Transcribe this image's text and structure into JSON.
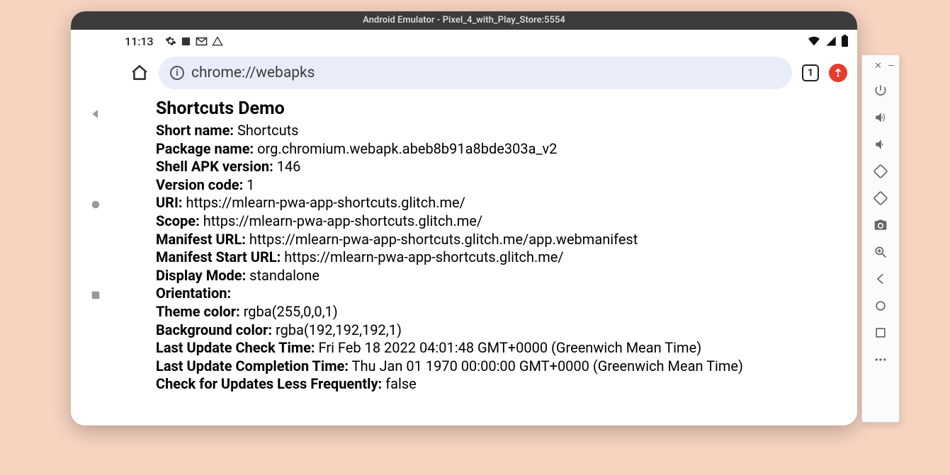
{
  "titlebar": "Android Emulator - Pixel_4_with_Play_Store:5554",
  "status": {
    "time": "11:13"
  },
  "chrome": {
    "url": "chrome://webapks",
    "tab_count": "1"
  },
  "page": {
    "title": "Shortcuts Demo",
    "rows": [
      {
        "label": "Short name:",
        "value": "Shortcuts"
      },
      {
        "label": "Package name:",
        "value": "org.chromium.webapk.abeb8b91a8bde303a_v2"
      },
      {
        "label": "Shell APK version:",
        "value": "146"
      },
      {
        "label": "Version code:",
        "value": "1"
      },
      {
        "label": "URI:",
        "value": "https://mlearn-pwa-app-shortcuts.glitch.me/"
      },
      {
        "label": "Scope:",
        "value": "https://mlearn-pwa-app-shortcuts.glitch.me/"
      },
      {
        "label": "Manifest URL:",
        "value": "https://mlearn-pwa-app-shortcuts.glitch.me/app.webmanifest"
      },
      {
        "label": "Manifest Start URL:",
        "value": "https://mlearn-pwa-app-shortcuts.glitch.me/"
      },
      {
        "label": "Display Mode:",
        "value": "standalone"
      },
      {
        "label": "Orientation:",
        "value": ""
      },
      {
        "label": "Theme color:",
        "value": "rgba(255,0,0,1)"
      },
      {
        "label": "Background color:",
        "value": "rgba(192,192,192,1)"
      },
      {
        "label": "Last Update Check Time:",
        "value": "Fri Feb 18 2022 04:01:48 GMT+0000 (Greenwich Mean Time)"
      },
      {
        "label": "Last Update Completion Time:",
        "value": "Thu Jan 01 1970 00:00:00 GMT+0000 (Greenwich Mean Time)"
      },
      {
        "label": "Check for Updates Less Frequently:",
        "value": "false"
      }
    ]
  }
}
